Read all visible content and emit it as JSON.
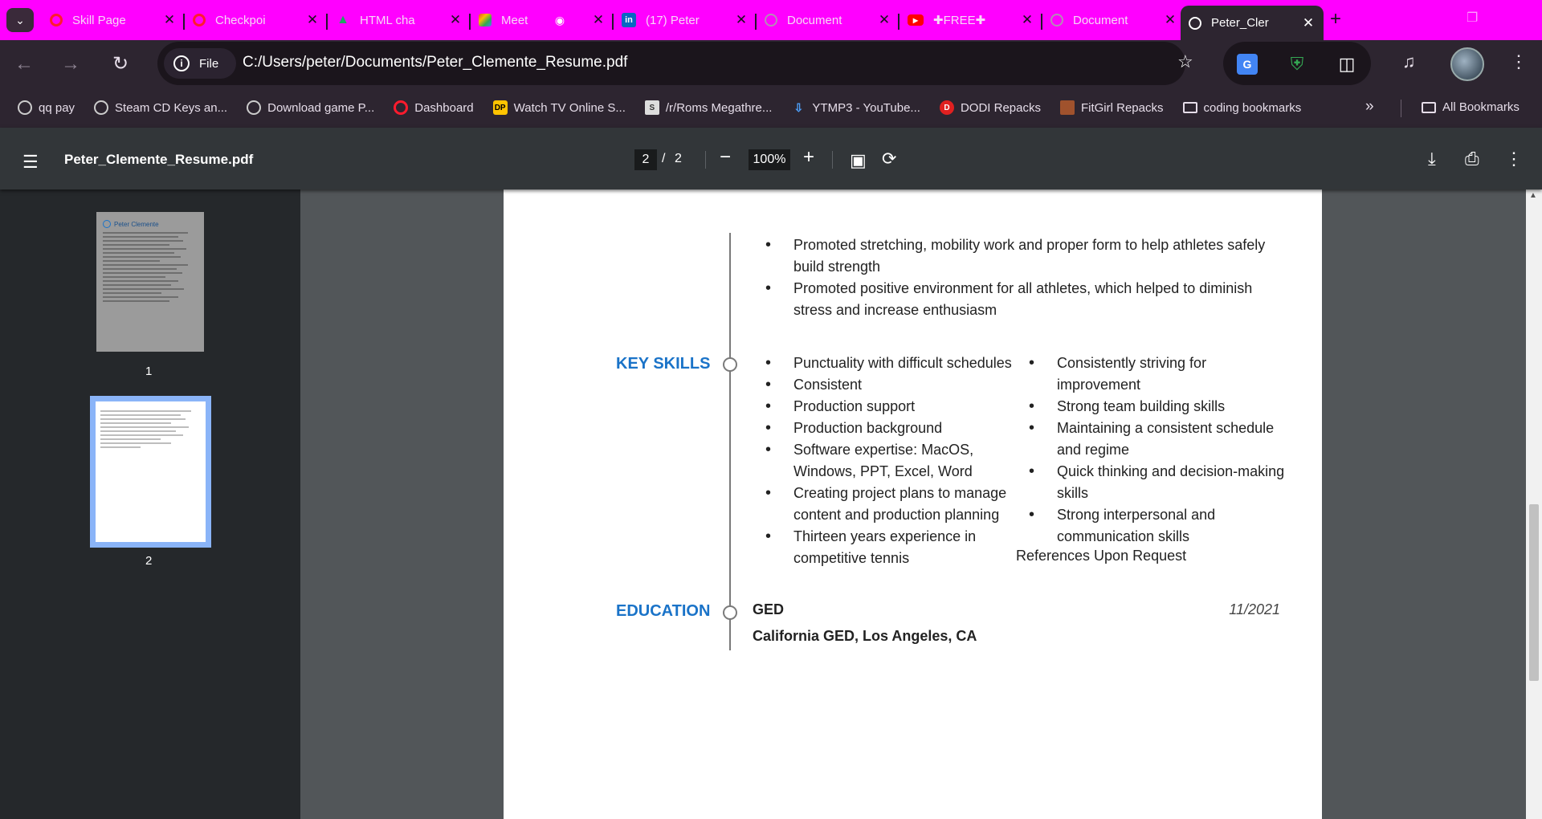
{
  "browser": {
    "tabs": [
      {
        "title": "Skill Page",
        "icon": "opera-icon",
        "color": "#ff1b2d"
      },
      {
        "title": "Checkpoi",
        "icon": "opera-icon",
        "color": "#ff1b2d"
      },
      {
        "title": "HTML cha",
        "icon": "google-drive-icon",
        "color": "#1fa463"
      },
      {
        "title": "Meet",
        "icon": "meet-icon",
        "color": "#00ac47"
      },
      {
        "title": "(17) Peter",
        "icon": "linkedin-icon",
        "color": "#0a66c2"
      },
      {
        "title": "Document",
        "icon": "globe-icon",
        "color": "#b58bb5"
      },
      {
        "title": "✚FREE✚",
        "icon": "youtube-icon",
        "color": "#ff0000"
      },
      {
        "title": "Document",
        "icon": "globe-icon",
        "color": "#b58bb5"
      },
      {
        "title": "Peter_Cler",
        "icon": "globe-icon",
        "color": "#ffffff"
      }
    ],
    "site_chip": "File",
    "url": "C:/Users/peter/Documents/Peter_Clemente_Resume.pdf",
    "bookmarks": [
      {
        "label": "qq pay",
        "icon": "opera-gx-icon"
      },
      {
        "label": "Steam CD Keys an...",
        "icon": "opera-gx-icon"
      },
      {
        "label": "Download game P...",
        "icon": "opera-gx-icon"
      },
      {
        "label": "Dashboard",
        "icon": "opera-icon"
      },
      {
        "label": "Watch TV Online S...",
        "icon": "dp-icon"
      },
      {
        "label": "/r/Roms Megathre...",
        "icon": "roms-icon"
      },
      {
        "label": "YTMP3 - YouTube...",
        "icon": "ytmp3-icon"
      },
      {
        "label": "DODI Repacks",
        "icon": "dodi-icon"
      },
      {
        "label": "FitGirl Repacks",
        "icon": "fitgirl-icon"
      },
      {
        "label": "coding bookmarks",
        "icon": "folder-icon"
      }
    ],
    "more_bookmarks": "»",
    "all_bookmarks": "All Bookmarks"
  },
  "pdf_viewer": {
    "file_name": "Peter_Clemente_Resume.pdf",
    "current_page": "2",
    "page_separator": "/",
    "total_pages": "2",
    "zoom": "100%",
    "thumbnails": [
      "1",
      "2"
    ]
  },
  "resume": {
    "prev_bullets": [
      "Promoted stretching, mobility work and proper form to help athletes safely build strength",
      "Promoted positive environment for all athletes, which helped to diminish stress and increase enthusiasm"
    ],
    "skills_heading": "KEY SKILLS",
    "skills_left": [
      "Punctuality with difficult schedules",
      "Consistent",
      "Production support",
      "Production background",
      "Software expertise: MacOS, Windows, PPT, Excel, Word",
      "Creating project plans to manage content and production planning",
      "Thirteen years experience in competitive tennis"
    ],
    "skills_right": [
      "Consistently striving for improvement",
      "Strong team building skills",
      "Maintaining a consistent schedule and regime",
      "Quick thinking and decision-making skills",
      "Strong interpersonal and communication skills"
    ],
    "references": "References Upon Request",
    "education_heading": "EDUCATION",
    "education": {
      "degree": "GED",
      "institution": "California GED, Los Angeles, CA",
      "date": "11/2021"
    },
    "thumbnail1_name": "Peter Clemente"
  }
}
